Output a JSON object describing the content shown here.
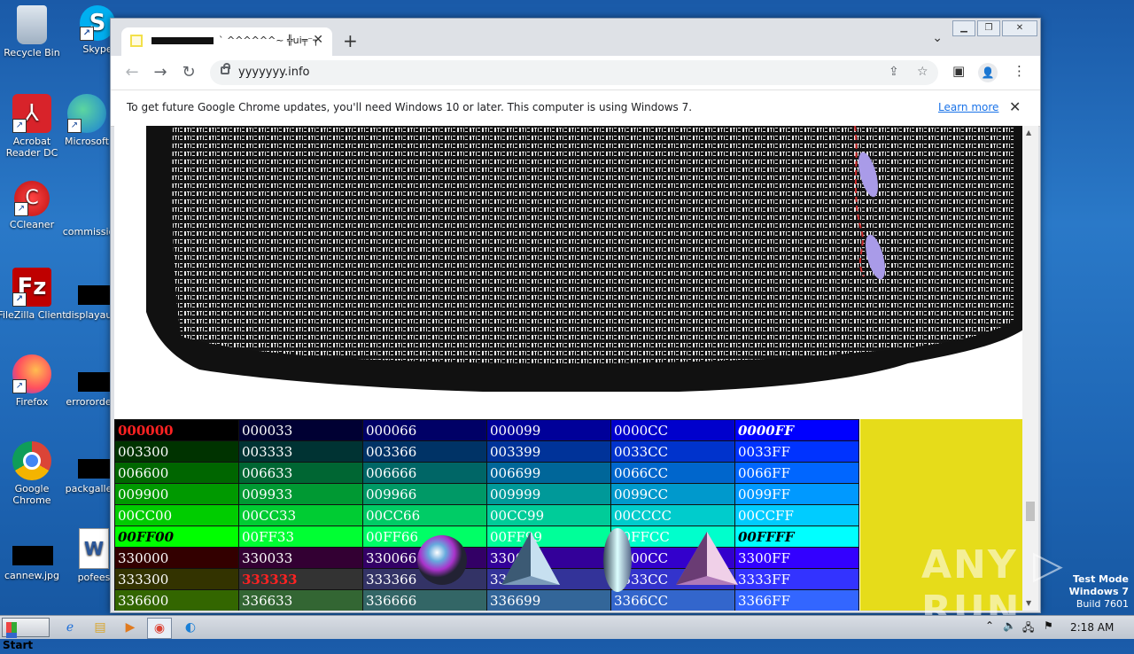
{
  "desktop": {
    "icons": [
      {
        "label": "Recycle Bin"
      },
      {
        "label": "Skype"
      },
      {
        "label": "Acrobat Reader DC"
      },
      {
        "label": "Microsoft"
      },
      {
        "label": "CCleaner"
      },
      {
        "label": "commissio"
      },
      {
        "label": "FileZilla Client"
      },
      {
        "label": "displayau"
      },
      {
        "label": "Firefox"
      },
      {
        "label": "errororde"
      },
      {
        "label": "Google Chrome"
      },
      {
        "label": "packgalle"
      },
      {
        "label": "cannew.jpg"
      },
      {
        "label": "pofees"
      }
    ]
  },
  "browser": {
    "tab": {
      "title": "` ^^^^^^~ ╬ui╤⁻┐",
      "close": "✕"
    },
    "new_tab": "+",
    "tab_menu": "⌄",
    "window_controls": {
      "minimize": "▁",
      "restore": "❐",
      "close": "✕"
    },
    "nav": {
      "back": "←",
      "forward": "→",
      "reload": "↻"
    },
    "url": "yyyyyyy.info",
    "infobar": {
      "text": "To get future Google Chrome updates, you'll need Windows 10 or later. This computer is using Windows 7.",
      "link": "Learn more",
      "close": "✕"
    }
  },
  "color_table": {
    "rows": [
      {
        "cells": [
          {
            "t": "000000",
            "bg": "#000000",
            "c": "#ff2222",
            "b": true
          },
          {
            "t": "000033",
            "bg": "#000033",
            "c": "#ffffff"
          },
          {
            "t": "000066",
            "bg": "#000066",
            "c": "#ffffff"
          },
          {
            "t": "000099",
            "bg": "#000099",
            "c": "#ffffff"
          },
          {
            "t": "0000CC",
            "bg": "#0000cc",
            "c": "#ffffff"
          },
          {
            "t": "0000FF",
            "bg": "#0000ff",
            "c": "#ffffff",
            "b": true,
            "i": true
          }
        ]
      },
      {
        "cells": [
          {
            "t": "003300",
            "bg": "#003300",
            "c": "#ffffff"
          },
          {
            "t": "003333",
            "bg": "#003333",
            "c": "#ffffff"
          },
          {
            "t": "003366",
            "bg": "#003366",
            "c": "#ffffff"
          },
          {
            "t": "003399",
            "bg": "#003399",
            "c": "#ffffff"
          },
          {
            "t": "0033CC",
            "bg": "#0033cc",
            "c": "#ffffff"
          },
          {
            "t": "0033FF",
            "bg": "#0033ff",
            "c": "#ffffff"
          }
        ]
      },
      {
        "cells": [
          {
            "t": "006600",
            "bg": "#006600",
            "c": "#ffffff"
          },
          {
            "t": "006633",
            "bg": "#006633",
            "c": "#ffffff"
          },
          {
            "t": "006666",
            "bg": "#006666",
            "c": "#ffffff"
          },
          {
            "t": "006699",
            "bg": "#006699",
            "c": "#ffffff"
          },
          {
            "t": "0066CC",
            "bg": "#0066cc",
            "c": "#ffffff"
          },
          {
            "t": "0066FF",
            "bg": "#0066ff",
            "c": "#ffffff"
          }
        ]
      },
      {
        "cells": [
          {
            "t": "009900",
            "bg": "#009900",
            "c": "#ffffff"
          },
          {
            "t": "009933",
            "bg": "#009933",
            "c": "#ffffff"
          },
          {
            "t": "009966",
            "bg": "#009966",
            "c": "#ffffff"
          },
          {
            "t": "009999",
            "bg": "#009999",
            "c": "#ffffff"
          },
          {
            "t": "0099CC",
            "bg": "#0099cc",
            "c": "#ffffff"
          },
          {
            "t": "0099FF",
            "bg": "#0099ff",
            "c": "#ffffff"
          }
        ]
      },
      {
        "cells": [
          {
            "t": "00CC00",
            "bg": "#00cc00",
            "c": "#ffffff"
          },
          {
            "t": "00CC33",
            "bg": "#00cc33",
            "c": "#ffffff"
          },
          {
            "t": "00CC66",
            "bg": "#00cc66",
            "c": "#ffffff"
          },
          {
            "t": "00CC99",
            "bg": "#00cc99",
            "c": "#ffffff"
          },
          {
            "t": "00CCCC",
            "bg": "#00cccc",
            "c": "#ffffff"
          },
          {
            "t": "00CCFF",
            "bg": "#00ccff",
            "c": "#ffffff"
          }
        ]
      },
      {
        "cells": [
          {
            "t": "00FF00",
            "bg": "#00ff00",
            "c": "#000000",
            "b": true,
            "i": true
          },
          {
            "t": "00FF33",
            "bg": "#00ff33",
            "c": "#ffffff"
          },
          {
            "t": "00FF66",
            "bg": "#00ff66",
            "c": "#ffffff"
          },
          {
            "t": "00FF99",
            "bg": "#00ff99",
            "c": "#ffffff"
          },
          {
            "t": "00FFCC",
            "bg": "#00ffcc",
            "c": "#ffffff"
          },
          {
            "t": "00FFFF",
            "bg": "#00ffff",
            "c": "#000000",
            "b": true,
            "i": true
          }
        ]
      },
      {
        "cells": [
          {
            "t": "330000",
            "bg": "#330000",
            "c": "#ffffff"
          },
          {
            "t": "330033",
            "bg": "#330033",
            "c": "#ffffff"
          },
          {
            "t": "330066",
            "bg": "#330066",
            "c": "#ffffff"
          },
          {
            "t": "330099",
            "bg": "#330099",
            "c": "#ffffff"
          },
          {
            "t": "3300CC",
            "bg": "#3300cc",
            "c": "#ffffff"
          },
          {
            "t": "3300FF",
            "bg": "#3300ff",
            "c": "#ffffff"
          }
        ]
      },
      {
        "cells": [
          {
            "t": "333300",
            "bg": "#333300",
            "c": "#ffffff"
          },
          {
            "t": "333333",
            "bg": "#333333",
            "c": "#ff2222",
            "b": true
          },
          {
            "t": "333366",
            "bg": "#333366",
            "c": "#ffffff"
          },
          {
            "t": "333399",
            "bg": "#333399",
            "c": "#ffffff"
          },
          {
            "t": "3333CC",
            "bg": "#3333cc",
            "c": "#ffffff"
          },
          {
            "t": "3333FF",
            "bg": "#3333ff",
            "c": "#ffffff"
          }
        ]
      },
      {
        "cells": [
          {
            "t": "336600",
            "bg": "#336600",
            "c": "#ffffff"
          },
          {
            "t": "336633",
            "bg": "#336633",
            "c": "#ffffff"
          },
          {
            "t": "336666",
            "bg": "#336666",
            "c": "#ffffff"
          },
          {
            "t": "336699",
            "bg": "#336699",
            "c": "#ffffff"
          },
          {
            "t": "3366CC",
            "bg": "#3366cc",
            "c": "#ffffff"
          },
          {
            "t": "3366FF",
            "bg": "#3366ff",
            "c": "#ffffff"
          }
        ]
      }
    ]
  },
  "watermark": "ANY ▷ RUN",
  "test_mode": {
    "line1": "Test Mode",
    "line2": "Windows 7",
    "line3": "Build 7601"
  },
  "taskbar": {
    "start": "Start",
    "clock": "2:18 AM"
  }
}
